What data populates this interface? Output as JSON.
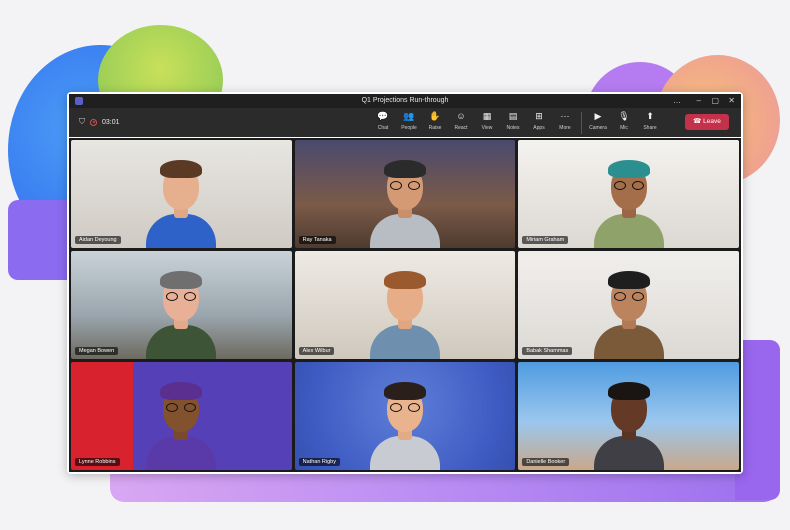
{
  "window": {
    "title": "Q1 Projections Run-through",
    "controls": [
      "…",
      "–",
      "▢",
      "✕"
    ]
  },
  "recording": {
    "time": "03:01"
  },
  "toolbar": {
    "items": [
      {
        "label": "Chat",
        "icon": "chat-icon",
        "glyph": "💬"
      },
      {
        "label": "People",
        "icon": "people-icon",
        "glyph": "👥"
      },
      {
        "label": "Raise",
        "icon": "raise-hand-icon",
        "glyph": "✋"
      },
      {
        "label": "React",
        "icon": "react-icon",
        "glyph": "☺"
      },
      {
        "label": "View",
        "icon": "view-icon",
        "glyph": "▦"
      },
      {
        "label": "Notes",
        "icon": "notes-icon",
        "glyph": "▤"
      },
      {
        "label": "Apps",
        "icon": "apps-icon",
        "glyph": "⊞"
      },
      {
        "label": "More",
        "icon": "more-icon",
        "glyph": "···"
      },
      {
        "label": "Camera",
        "icon": "camera-icon",
        "glyph": "▶"
      },
      {
        "label": "Mic",
        "icon": "mic-icon",
        "glyph": "🎙"
      },
      {
        "label": "Share",
        "icon": "share-icon",
        "glyph": "⬆"
      }
    ],
    "leave_label": "Leave"
  },
  "participants": [
    {
      "name": "Aidan Deyoung"
    },
    {
      "name": "Ray Tanaka"
    },
    {
      "name": "Miriam Graham"
    },
    {
      "name": "Megan Bowen"
    },
    {
      "name": "Alex Wilbur"
    },
    {
      "name": "Babak Shammas"
    },
    {
      "name": "Lynne Robbins"
    },
    {
      "name": "Nathan Rigby"
    },
    {
      "name": "Danielle Booker"
    }
  ],
  "colors": {
    "leave": "#c4314b",
    "accent": "#5b5fc7"
  }
}
